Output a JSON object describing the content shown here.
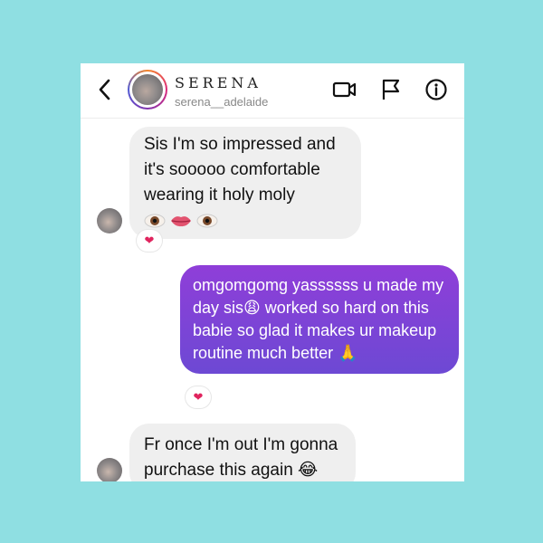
{
  "header": {
    "name": "SERENA",
    "handle": "serena__adelaide",
    "icons": [
      "back-chevron-icon",
      "video-call-icon",
      "flag-icon",
      "info-icon"
    ]
  },
  "messages": [
    {
      "direction": "incoming",
      "text": "Sis I'm so impressed and it's sooooo comfortable wearing it holy moly",
      "emojis": [
        "eye-emoji",
        "lips-emoji",
        "eye-emoji"
      ],
      "reaction": "❤"
    },
    {
      "direction": "outgoing",
      "text": "omgomgomg yassssss u made my day sis😩  worked so hard on this babie so glad it makes ur makeup routine much better 🙏",
      "reaction": "❤"
    },
    {
      "direction": "incoming",
      "text": "Fr once I'm out I'm gonna purchase this again 😂"
    }
  ],
  "colors": {
    "background": "#8fdfe2",
    "incoming_bubble": "#efefef",
    "outgoing_bubble": "#7a45d6",
    "reaction_heart": "#e0245e"
  }
}
